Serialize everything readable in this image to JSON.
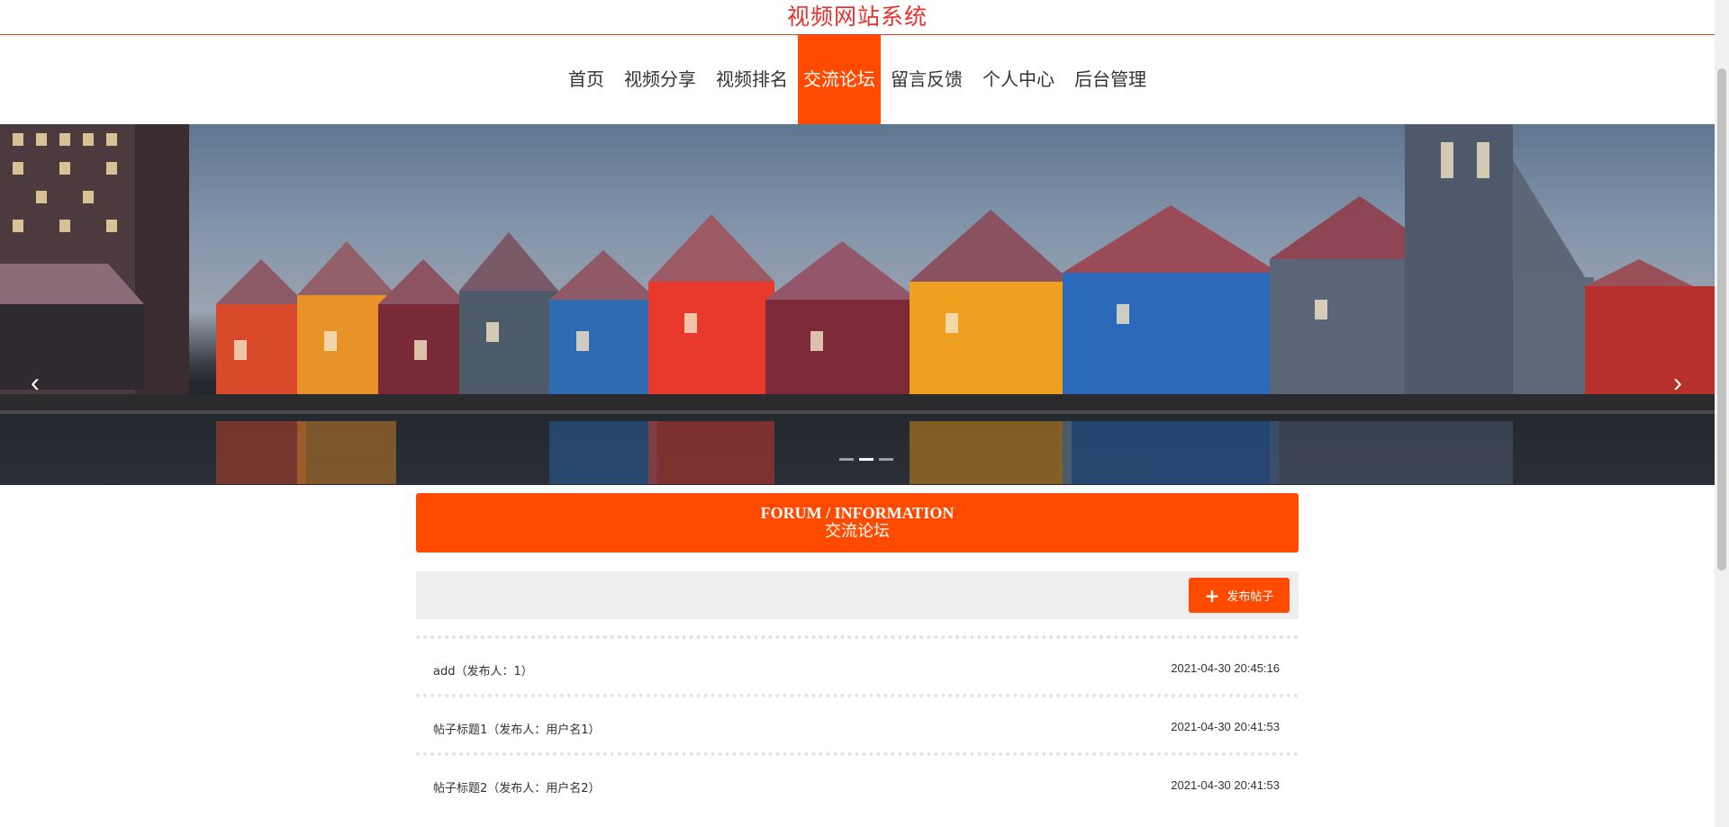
{
  "header": {
    "site_title": "视频网站系统"
  },
  "nav": {
    "items": [
      {
        "label": "首页",
        "active": false
      },
      {
        "label": "视频分享",
        "active": false
      },
      {
        "label": "视频排名",
        "active": false
      },
      {
        "label": "交流论坛",
        "active": true
      },
      {
        "label": "留言反馈",
        "active": false
      },
      {
        "label": "个人中心",
        "active": false
      },
      {
        "label": "后台管理",
        "active": false
      }
    ],
    "active_color": "#ff4a00"
  },
  "banner": {
    "prev_icon": "chevron-left-icon",
    "next_icon": "chevron-right-icon",
    "slide_count": 3,
    "active_slide": 2
  },
  "section": {
    "title_en": "FORUM / INFORMATION",
    "title_cn": "交流论坛"
  },
  "toolbar": {
    "post_button_label": "发布帖子",
    "post_button_icon": "plus-icon"
  },
  "posts": [
    {
      "title": "add（发布人：1）",
      "time": "2021-04-30 20:45:16"
    },
    {
      "title": "帖子标题1（发布人：用户名1）",
      "time": "2021-04-30 20:41:53"
    },
    {
      "title": "帖子标题2（发布人：用户名2）",
      "time": "2021-04-30 20:41:53"
    }
  ],
  "colors": {
    "accent": "#ff4a00",
    "title_red": "#e5322d"
  }
}
